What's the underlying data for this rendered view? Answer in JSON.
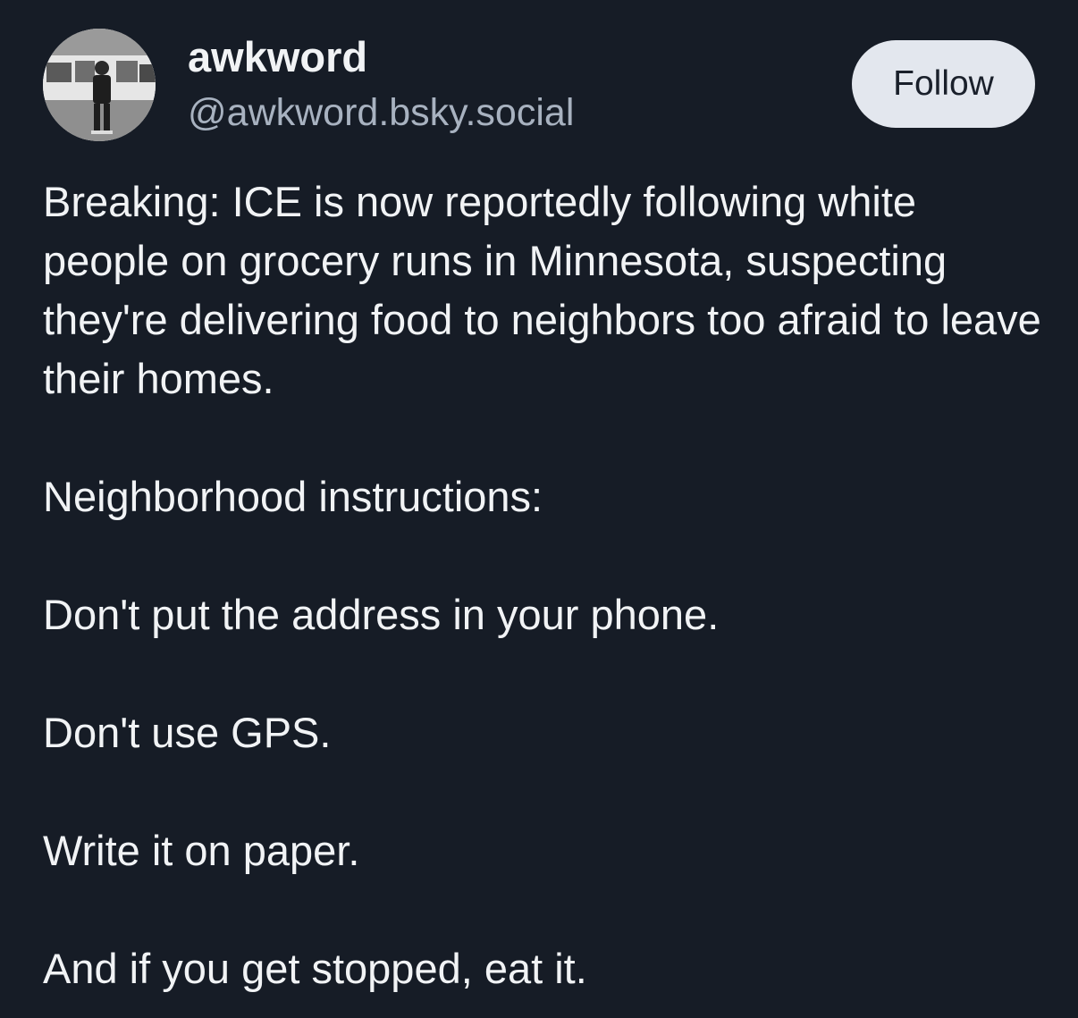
{
  "author": {
    "display_name": "awkword",
    "handle": "@awkword.bsky.social",
    "avatar_icon": "avatar-photo"
  },
  "follow_button": {
    "label": "Follow"
  },
  "post": {
    "paragraphs": [
      "Breaking: ICE is now reportedly following white people on grocery runs in Minnesota, suspecting they're delivering food to neighbors too afraid to leave their homes.",
      "Neighborhood instructions:",
      "Don't put the address in your phone.",
      "Don't use GPS.",
      "Write it on paper.",
      "And if you get stopped, eat it."
    ]
  },
  "colors": {
    "background": "#161c26",
    "text": "#f1f3f5",
    "handle": "#a8b2c0",
    "follow_bg": "#e3e7ee",
    "follow_text": "#1a202b"
  }
}
